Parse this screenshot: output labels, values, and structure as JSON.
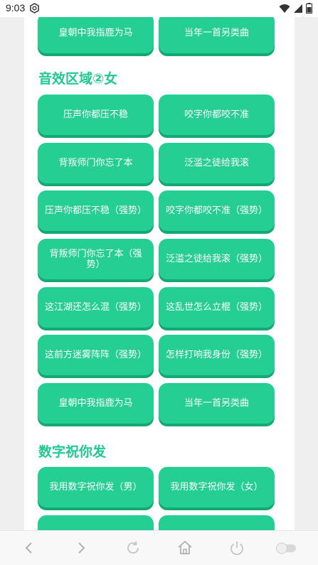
{
  "status_bar": {
    "time": "9:03"
  },
  "sections": [
    {
      "title": "音效区域②女"
    },
    {
      "title": "数字祝你发"
    }
  ],
  "top_buttons": [
    "皇朝中我指鹿为马",
    "当年一首另类曲"
  ],
  "section1_buttons": [
    "压声你都压不稳",
    "咬字你都咬不准",
    "背叛师门你忘了本",
    "泛滥之徒给我滚",
    "压声你都压不稳（强势）",
    "咬字你都咬不准（强势）",
    "背叛师门你忘了本（强势）",
    "泛滥之徒给我滚（强势）",
    "这江湖还怎么混（强势）",
    "这乱世怎么立棍（强势）",
    "这前方迷雾阵阵（强势）",
    "怎样打响我身份（强势）",
    "皇朝中我指鹿为马",
    "当年一首另类曲"
  ],
  "section2_buttons": [
    "我用数字祝你发（男）",
    "我用数字祝你发（女）"
  ],
  "colors": {
    "button": "#25cf93",
    "button_shadow": "#13a874",
    "title": "#20c98e"
  },
  "nav_icons": [
    "back-icon",
    "forward-icon",
    "refresh-icon",
    "home-icon",
    "power-icon",
    "toggle-switch"
  ]
}
